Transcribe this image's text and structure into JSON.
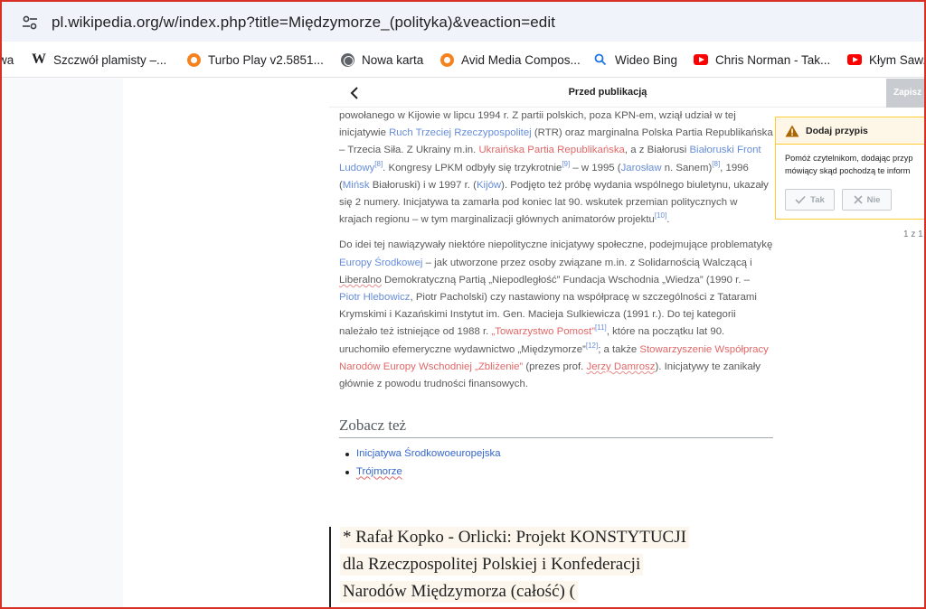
{
  "browser": {
    "url": "pl.wikipedia.org/w/index.php?title=Międzymorze_(polityka)&veaction=edit",
    "bookmarks": [
      {
        "label": "wa",
        "icon": "none"
      },
      {
        "label": "Szczwół plamisty –...",
        "icon": "wikipedia-icon"
      },
      {
        "label": "Turbo Play v2.5851...",
        "icon": "turbo-icon"
      },
      {
        "label": "Nowa karta",
        "icon": "globe-icon"
      },
      {
        "label": "Avid Media Compos...",
        "icon": "turbo-icon"
      },
      {
        "label": "Wideo Bing",
        "icon": "search-icon"
      },
      {
        "label": "Chris Norman - Tak...",
        "icon": "youtube-icon"
      },
      {
        "label": "Kłym Saw...",
        "icon": "youtube-icon"
      }
    ]
  },
  "editor": {
    "title": "Przed publikacją",
    "save_label": "Zapisz"
  },
  "article": {
    "p1": {
      "t1": "powołanego w Kijowie w lipcu 1994 r. Z partii polskich, poza KPN-em, wziął udział w tej inicjatywie ",
      "l1": "Ruch Trzeciej Rzeczypospolitej",
      "t2": " (RTR) oraz marginalna Polska Partia Republikańska – Trzecia Siła. Z Ukrainy m.in. ",
      "n1": "Ukraińska Partia Republikańska",
      "t3": ", a z Białorusi ",
      "l2": "Białoruski Front Ludowy",
      "s1": "[8]",
      "t4": ". Kongresy LPKM odbyły się trzykrotnie",
      "s2": "[9]",
      "t5": " – w 1995 (",
      "l3": "Jarosław",
      "t6": " n. Sanem)",
      "s3": "[8]",
      "t7": ", 1996 (",
      "l4": "Mińsk",
      "t8": " Białoruski) i w 1997 r. (",
      "l5": "Kijów",
      "t9": "). Podjęto też próbę wydania wspólnego biuletynu, ukazały się 2 numery. Inicjatywa ta zamarła pod koniec lat 90. wskutek przemian politycznych w krajach regionu – w tym marginalizacji głównych animatorów projektu",
      "s4": "[10]",
      "t10": "."
    },
    "p2": {
      "t1": "Do idei tej nawiązywały niektóre niepolityczne inicjatywy społeczne, podejmujące problematykę ",
      "l1": "Europy Środkowej",
      "t2": " – jak utworzone przez osoby związane m.in. z Solidarnością Walczącą i ",
      "w1": "Liberalno",
      "t3": " Demokratyczną Partią „Niepodległość” Fundacja Wschodnia „Wiedza” (1990 r. – ",
      "l2": "Piotr Hlebowicz",
      "t4": ", Piotr Pacholski) czy nastawiony na współpracę w szczególności z Tatarami Krymskimi i Kazańskimi Instytut im. Gen. Macieja Sulkiewicza (1991 r.). Do tej kategorii należało też istniejące od 1988 r. ",
      "n1": "„Towarzystwo Pomost”",
      "s1": "[11]",
      "t5": ", które na początku lat 90. uruchomiło efemeryczne wydawnictwo „Międzymorze”",
      "s2": "[12]",
      "t6": "; a także ",
      "n2": "Stowarzyszenie Współpracy Narodów Europy Wschodniej „Zbliżenie”",
      "t7": " (prezes prof. ",
      "n3": "Jerzy Damrosz",
      "t8": "). Inicjatywy te zanikały głównie z powodu trudności finansowych."
    },
    "see_also": {
      "heading": "Zobacz też",
      "items": [
        "Inicjatywa Środkowoeuropejska",
        "Trójmorze"
      ]
    },
    "quote_lines": [
      "* Rafał Kopko - Orlicki: Projekt KONSTYTUCJI",
      "dla Rzeczpospolitej Polskiej i Konfederacji",
      "Narodów Międzymorza (całość) ("
    ]
  },
  "popup": {
    "title": "Dodaj przypis",
    "body_line1": "Pomóż czytelnikom, dodając przyp",
    "body_line2": "mówiący skąd pochodzą te inform",
    "yes_label": "Tak",
    "no_label": "Nie",
    "counter": "1 z 1"
  },
  "colors": {
    "link": "#3366cc",
    "redlink": "#d73333",
    "warning": "#fc3",
    "frame": "#d93025"
  }
}
